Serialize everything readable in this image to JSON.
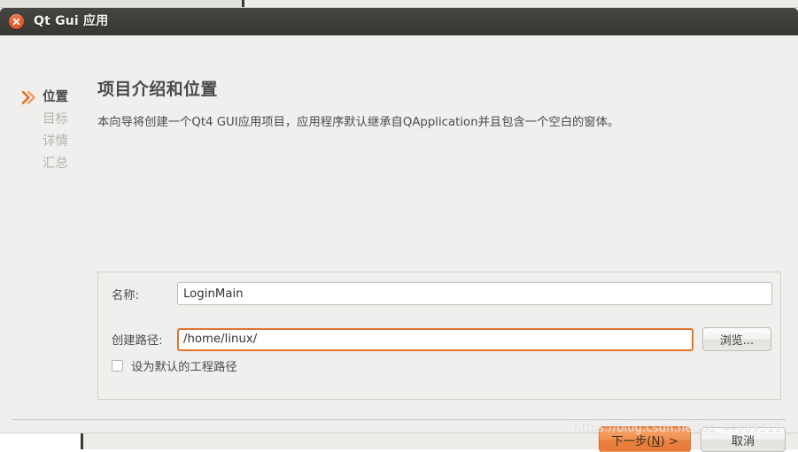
{
  "window": {
    "title": "Qt Gui 应用",
    "close_icon": "close-icon"
  },
  "sidebar": {
    "items": [
      {
        "label": "位置",
        "active": true
      },
      {
        "label": "目标",
        "active": false
      },
      {
        "label": "详情",
        "active": false
      },
      {
        "label": "汇总",
        "active": false
      }
    ]
  },
  "header": {
    "title": "项目介绍和位置",
    "description": "本向导将创建一个Qt4 GUI应用项目，应用程序默认继承自QApplication并且包含一个空白的窗体。"
  },
  "form": {
    "name_label": "名称:",
    "name_value": "LoginMain",
    "name_placeholder": "",
    "path_label": "创建路径:",
    "path_value": "/home/linux/",
    "path_placeholder": "",
    "browse_label": "浏览...",
    "checkbox_label": "设为默认的工程路径",
    "checkbox_checked": false
  },
  "footer": {
    "next_label_prefix": "下一步(",
    "next_mnemonic": "N",
    "next_label_suffix": ") >",
    "cancel_label": "取消"
  },
  "watermark": {
    "text": "https://blog.csdn.net/qq_44009311"
  },
  "colors": {
    "accent_orange": "#e2732d",
    "next_button": "#ea8140",
    "titlebar": "#3f3d3a",
    "dialog_bg": "#f0efed",
    "step_inactive": "#b4b2ae",
    "step_active": "#4a4a48"
  }
}
